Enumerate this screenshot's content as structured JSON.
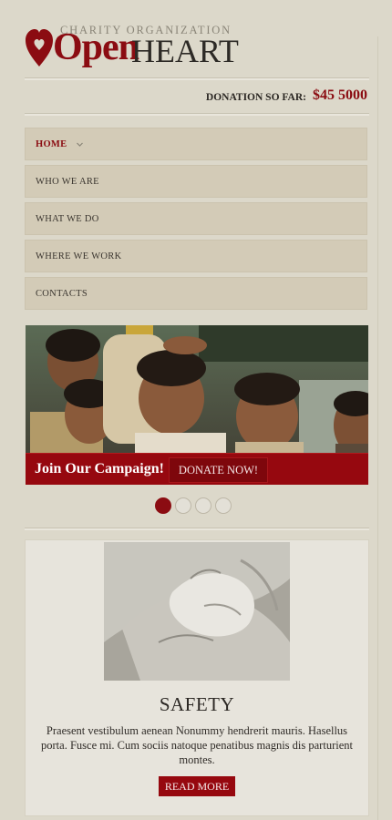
{
  "header": {
    "tagline": "CHARITY ORGANIZATION",
    "logo_open": "Open",
    "logo_heart": "HEART",
    "donation_label": "DONATION SO FAR:",
    "donation_amount": "$45 5000"
  },
  "nav": {
    "items": [
      {
        "label": "HOME",
        "active": true
      },
      {
        "label": "WHO WE ARE"
      },
      {
        "label": "WHAT WE DO"
      },
      {
        "label": "WHERE WE WORK"
      },
      {
        "label": "CONTACTS"
      }
    ]
  },
  "slider": {
    "banner_text": "Join Our Campaign!",
    "button_label": "DONATE NOW!",
    "dot_count": 4,
    "active_dot": 0
  },
  "article": {
    "title": "SAFETY",
    "text": "Praesent vestibulum aenean Nonummy hendrerit mauris. Hasellus porta. Fusce mi. Cum sociis natoque penatibus magnis dis parturient montes.",
    "button_label": "READ MORE"
  },
  "colors": {
    "accent": "#8b0c12",
    "background": "#dcd8ca"
  }
}
